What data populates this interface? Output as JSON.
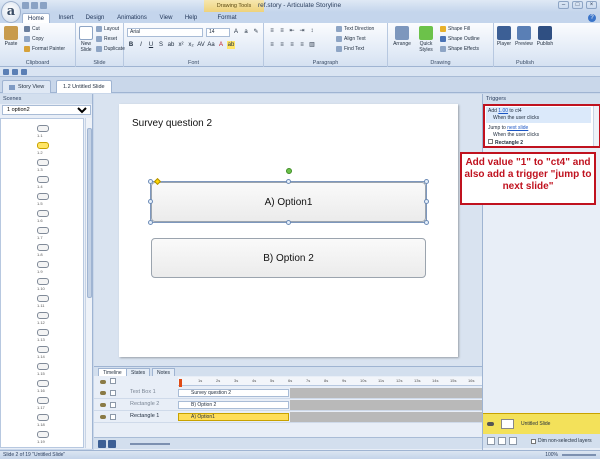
{
  "app": {
    "logo_letter": "a",
    "contextual_tab_group": "Drawing Tools",
    "title": "ref.story - Articulate Storyline"
  },
  "ribbon": {
    "tabs": [
      "Home",
      "Insert",
      "Design",
      "Animations",
      "View",
      "Help",
      "Format"
    ],
    "clipboard": {
      "paste": "Paste",
      "cut": "Cut",
      "copy": "Copy",
      "format_painter": "Format Painter",
      "label": "Clipboard"
    },
    "slide": {
      "new_slide": "New Slide",
      "layout": "Layout",
      "reset": "Reset",
      "duplicate": "Duplicate",
      "label": "Slide"
    },
    "font": {
      "family": "Arial",
      "size": "14",
      "label": "Font"
    },
    "paragraph": {
      "text_direction": "Text Direction",
      "align_text": "Align Text",
      "find_text": "Find Text",
      "label": "Paragraph"
    },
    "drawing": {
      "arrange": "Arrange",
      "quick_styles": "Quick Styles",
      "shape_fill": "Shape Fill",
      "shape_outline": "Shape Outline",
      "shape_effects": "Shape Effects",
      "label": "Drawing"
    },
    "publish": {
      "player": "Player",
      "preview": "Preview",
      "publish": "Publish",
      "label": "Publish"
    }
  },
  "doc_tabs": [
    "Story View",
    "1.2 Untitled Slide"
  ],
  "scenes": {
    "title": "Scenes",
    "selected": "1 option2",
    "thumbs": [
      "1.1",
      "1.2",
      "1.3",
      "1.4",
      "1.5",
      "1.6",
      "1.7",
      "1.8",
      "1.9",
      "1.10",
      "1.11",
      "1.12",
      "1.13",
      "1.14",
      "1.15",
      "1.16",
      "1.17",
      "1.18",
      "1.19"
    ]
  },
  "slide": {
    "title": "Survey question 2",
    "option1": "A) Option1",
    "option2": "B) Option 2"
  },
  "timeline": {
    "tabs": [
      "Timeline",
      "States",
      "Notes"
    ],
    "rows": [
      {
        "name": "Text Box 1",
        "bar": "Survey question 2"
      },
      {
        "name": "Rectangle 2",
        "bar": "B) Option 2"
      },
      {
        "name": "Rectangle 1",
        "bar": "A) Option1"
      }
    ],
    "ruler": [
      "1s",
      "2s",
      "3s",
      "4s",
      "5s",
      "6s",
      "7s",
      "8s",
      "9s",
      "10s",
      "11s",
      "12s",
      "13s",
      "14s",
      "15s",
      "16s"
    ]
  },
  "triggers": {
    "title": "Triggers",
    "t1_prefix": "Add",
    "t1_value": "1.00",
    "t1_suffix": "to ct4",
    "t1_when": "When the user clicks",
    "t2_prefix": "Jump to",
    "t2_target": "next slide",
    "t2_when": "When the user clicks",
    "object": "Rectangle 2"
  },
  "callout": "Add value \"1\" to \"ct4\" and also add a trigger \"jump to next slide\"",
  "layers": {
    "base": "Untitled Slide",
    "dim": "Dim non-selected layers"
  },
  "status": {
    "left": "Slide 2 of 19   \"Untitled Slide\"",
    "zoom": "100%"
  },
  "colors": {
    "accent_red": "#c0121f",
    "selected_yellow": "#ffde59"
  }
}
